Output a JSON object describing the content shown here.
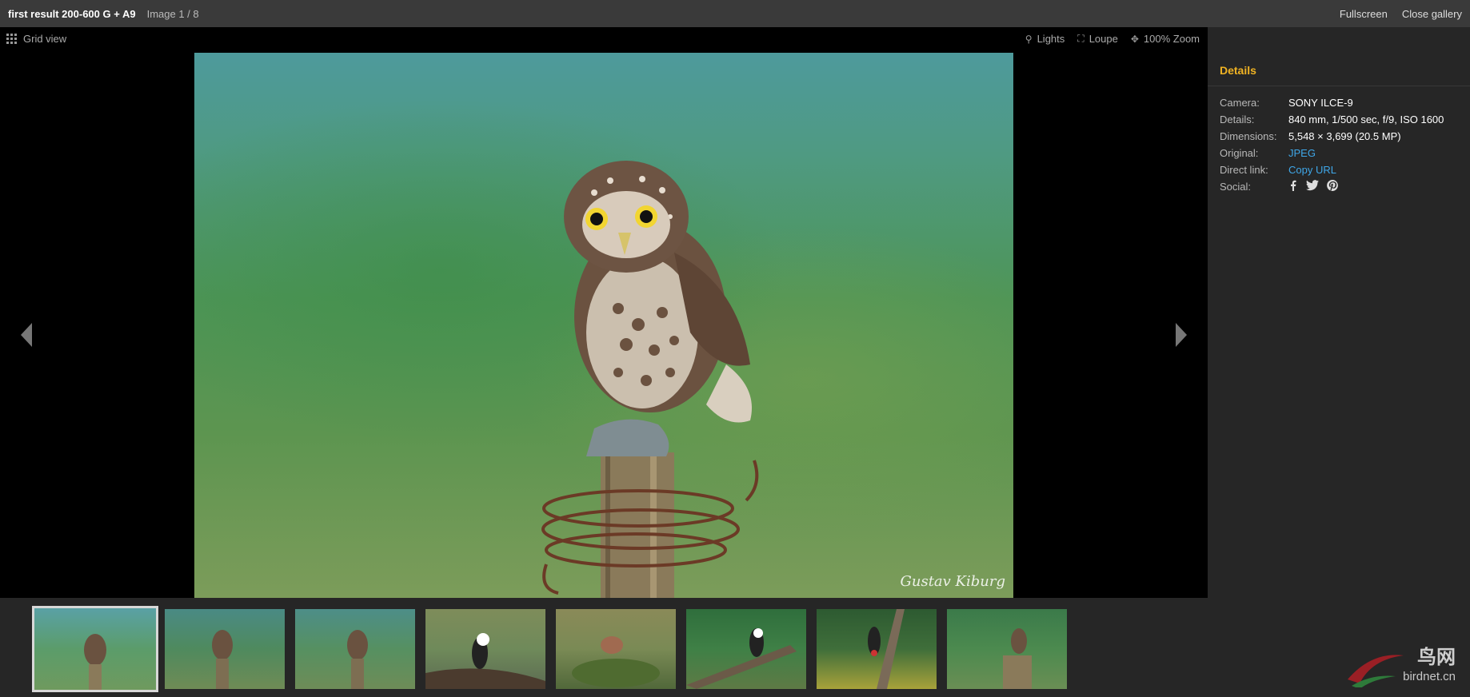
{
  "header": {
    "title": "first result 200-600 G + A9",
    "counter": "Image 1 / 8",
    "fullscreen_label": "Fullscreen",
    "close_label": "Close gallery"
  },
  "toolbar": {
    "gridview_label": "Grid view",
    "lights_label": "Lights",
    "loupe_label": "Loupe",
    "zoom_label": "100% Zoom"
  },
  "photo": {
    "watermark": "Gustav Kiburg"
  },
  "thumbnails": [
    {
      "subject": "owl",
      "active": true
    },
    {
      "subject": "owl"
    },
    {
      "subject": "owl"
    },
    {
      "subject": "woodpecker"
    },
    {
      "subject": "hawfinch"
    },
    {
      "subject": "woodpecker"
    },
    {
      "subject": "woodpecker"
    },
    {
      "subject": "owl"
    }
  ],
  "sidebar": {
    "heading": "Details",
    "rows": {
      "camera_label": "Camera:",
      "camera_value": "SONY ILCE-9",
      "details_label": "Details:",
      "details_value": "840 mm, 1/500 sec, f/9, ISO 1600",
      "dimensions_label": "Dimensions:",
      "dimensions_value": "5,548 × 3,699 (20.5 MP)",
      "original_label": "Original:",
      "original_value": "JPEG",
      "direct_label": "Direct link:",
      "direct_value": "Copy URL",
      "social_label": "Social:"
    },
    "social_icons": [
      "facebook-icon",
      "twitter-icon",
      "pinterest-icon"
    ]
  },
  "logo": {
    "cn": "鸟网",
    "url": "birdnet.cn"
  },
  "colors": {
    "accent": "#f0b323",
    "link": "#3fa7e8",
    "topbar": "#3a3a3a",
    "sidebar": "#262626"
  }
}
